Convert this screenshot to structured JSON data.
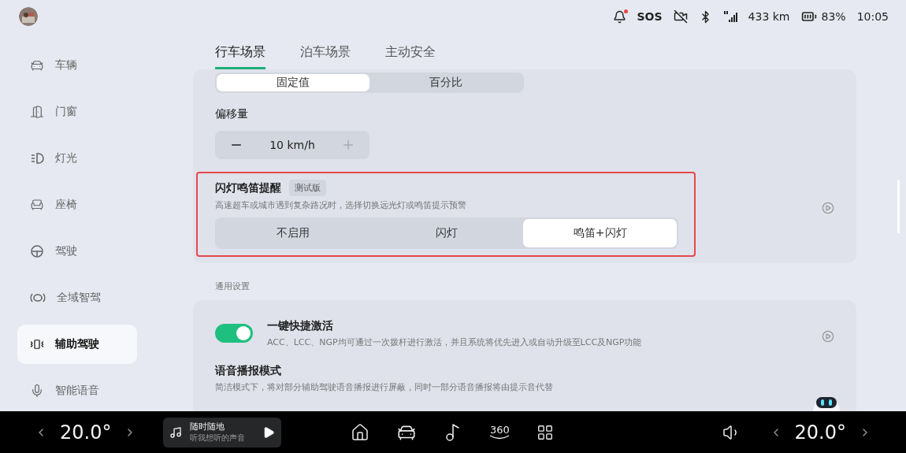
{
  "status_bar": {
    "notification": true,
    "sos": "SOS",
    "range": "433 km",
    "battery": "83%",
    "time": "10:05"
  },
  "sidebar": {
    "items": [
      {
        "label": "车辆",
        "selected": false
      },
      {
        "label": "门窗",
        "selected": false
      },
      {
        "label": "灯光",
        "selected": false
      },
      {
        "label": "座椅",
        "selected": false
      },
      {
        "label": "驾驶",
        "selected": false
      },
      {
        "label": "全域智驾",
        "selected": false
      },
      {
        "label": "辅助驾驶",
        "selected": true
      },
      {
        "label": "智能语音",
        "selected": false
      }
    ]
  },
  "tabs": [
    {
      "label": "行车场景",
      "selected": true
    },
    {
      "label": "泊车场景",
      "selected": false
    },
    {
      "label": "主动安全",
      "selected": false
    }
  ],
  "unit_segments": [
    {
      "label": "固定值",
      "selected": true
    },
    {
      "label": "百分比",
      "selected": false
    }
  ],
  "offset": {
    "label": "偏移量",
    "value": "10 km/h"
  },
  "flash_horn": {
    "title": "闪灯鸣笛提醒",
    "badge": "测试版",
    "description": "高速超车或城市遇到复杂路况时，选择切换远光灯或鸣笛提示预警",
    "highlighted": true,
    "options": [
      {
        "label": "不启用",
        "selected": false
      },
      {
        "label": "闪灯",
        "selected": false
      },
      {
        "label": "鸣笛+闪灯",
        "selected": true
      }
    ]
  },
  "general_heading": "通用设置",
  "quick_activate": {
    "title": "一键快捷激活",
    "description": "ACC、LCC、NGP均可通过一次拨杆进行激活，并且系统将优先进入或自动升级至LCC及NGP功能",
    "on": true
  },
  "voice_mode": {
    "title": "语音播报模式",
    "description": "简洁模式下，将对部分辅助驾驶语音播报进行屏蔽，同时一部分语音播报将由提示音代替"
  },
  "dock": {
    "left_temp": "20.0°",
    "media": {
      "title": "随时随地",
      "subtitle": "听我想听的声音"
    },
    "view_360": "360",
    "right_temp": "20.0°"
  }
}
